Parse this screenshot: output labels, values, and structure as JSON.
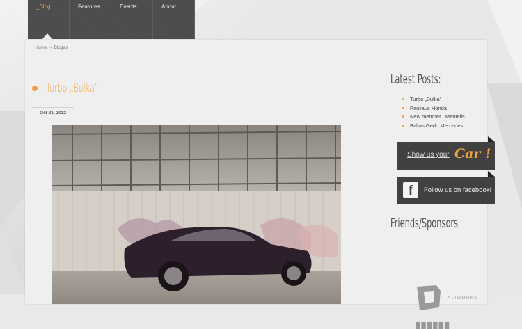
{
  "nav": {
    "items": [
      {
        "label": "_Blog",
        "active": true
      },
      {
        "label": "Features"
      },
      {
        "label": "Events"
      },
      {
        "label": "About"
      }
    ]
  },
  "breadcrumb": "Home → Blogas",
  "post": {
    "title": "Turbo „Bulka”",
    "date": "Oct 31, 2012"
  },
  "sidebar": {
    "latest_heading": "Latest Posts:",
    "latest_posts": [
      "Turbo „Bulka”",
      "Pauliaus Honda",
      "New member : Mantelis",
      "Baltas Gedo Mercedes"
    ],
    "show_banner": {
      "text": "Show us your",
      "word": "Car !"
    },
    "facebook_banner": {
      "icon": "facebook-icon",
      "text": "Follow us on facebook!"
    },
    "friends_heading": "Friends/Sponsors",
    "sponsor_label": "ALIWORKS"
  },
  "colors": {
    "accent": "#f0a040",
    "nav_bg": "#4a4a4a",
    "banner_bg": "#3d3d3d"
  }
}
